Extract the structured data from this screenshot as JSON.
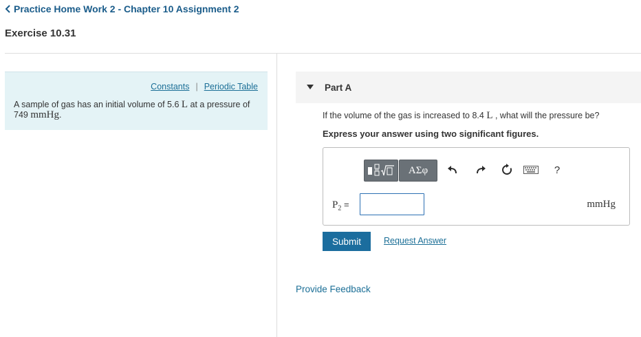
{
  "breadcrumb": {
    "back_label": "Practice Home Work 2 - Chapter 10 Assignment 2"
  },
  "exercise": {
    "title": "Exercise 10.31"
  },
  "info": {
    "links": [
      "Constants",
      "Periodic Table"
    ],
    "separator": "|",
    "problem": {
      "text1": "A sample of gas has an initial volume of 5.6 ",
      "unit1": "L",
      "text2": " at a pressure of 749 ",
      "unit2": "mmHg",
      "text3": "."
    }
  },
  "part_a": {
    "label": "Part A",
    "question": {
      "text1": "If the volume of the gas is increased to 8.4 ",
      "unit": "L",
      "text2": " , what will the pressure be?"
    },
    "instruction": "Express your answer using two significant figures.",
    "toolbar": {
      "greek_label": "ΑΣφ",
      "help_label": "?",
      "icons": [
        "templates-icon",
        "undo-icon",
        "redo-icon",
        "reset-icon",
        "keyboard-icon",
        "help-icon"
      ]
    },
    "variable": {
      "symbol": "P",
      "subscript": "2",
      "equals": "="
    },
    "answer_value": "",
    "unit": "mmHg",
    "submit_label": "Submit",
    "request_label": "Request Answer"
  },
  "feedback_label": "Provide Feedback",
  "colors": {
    "link": "#1a6e96",
    "header_link": "#1a5c8a",
    "info_bg": "#e4f3f6",
    "submit_bg": "#1b6d9e",
    "toolbar_btn": "#6a7177",
    "parta_bg": "#f4f4f4"
  }
}
